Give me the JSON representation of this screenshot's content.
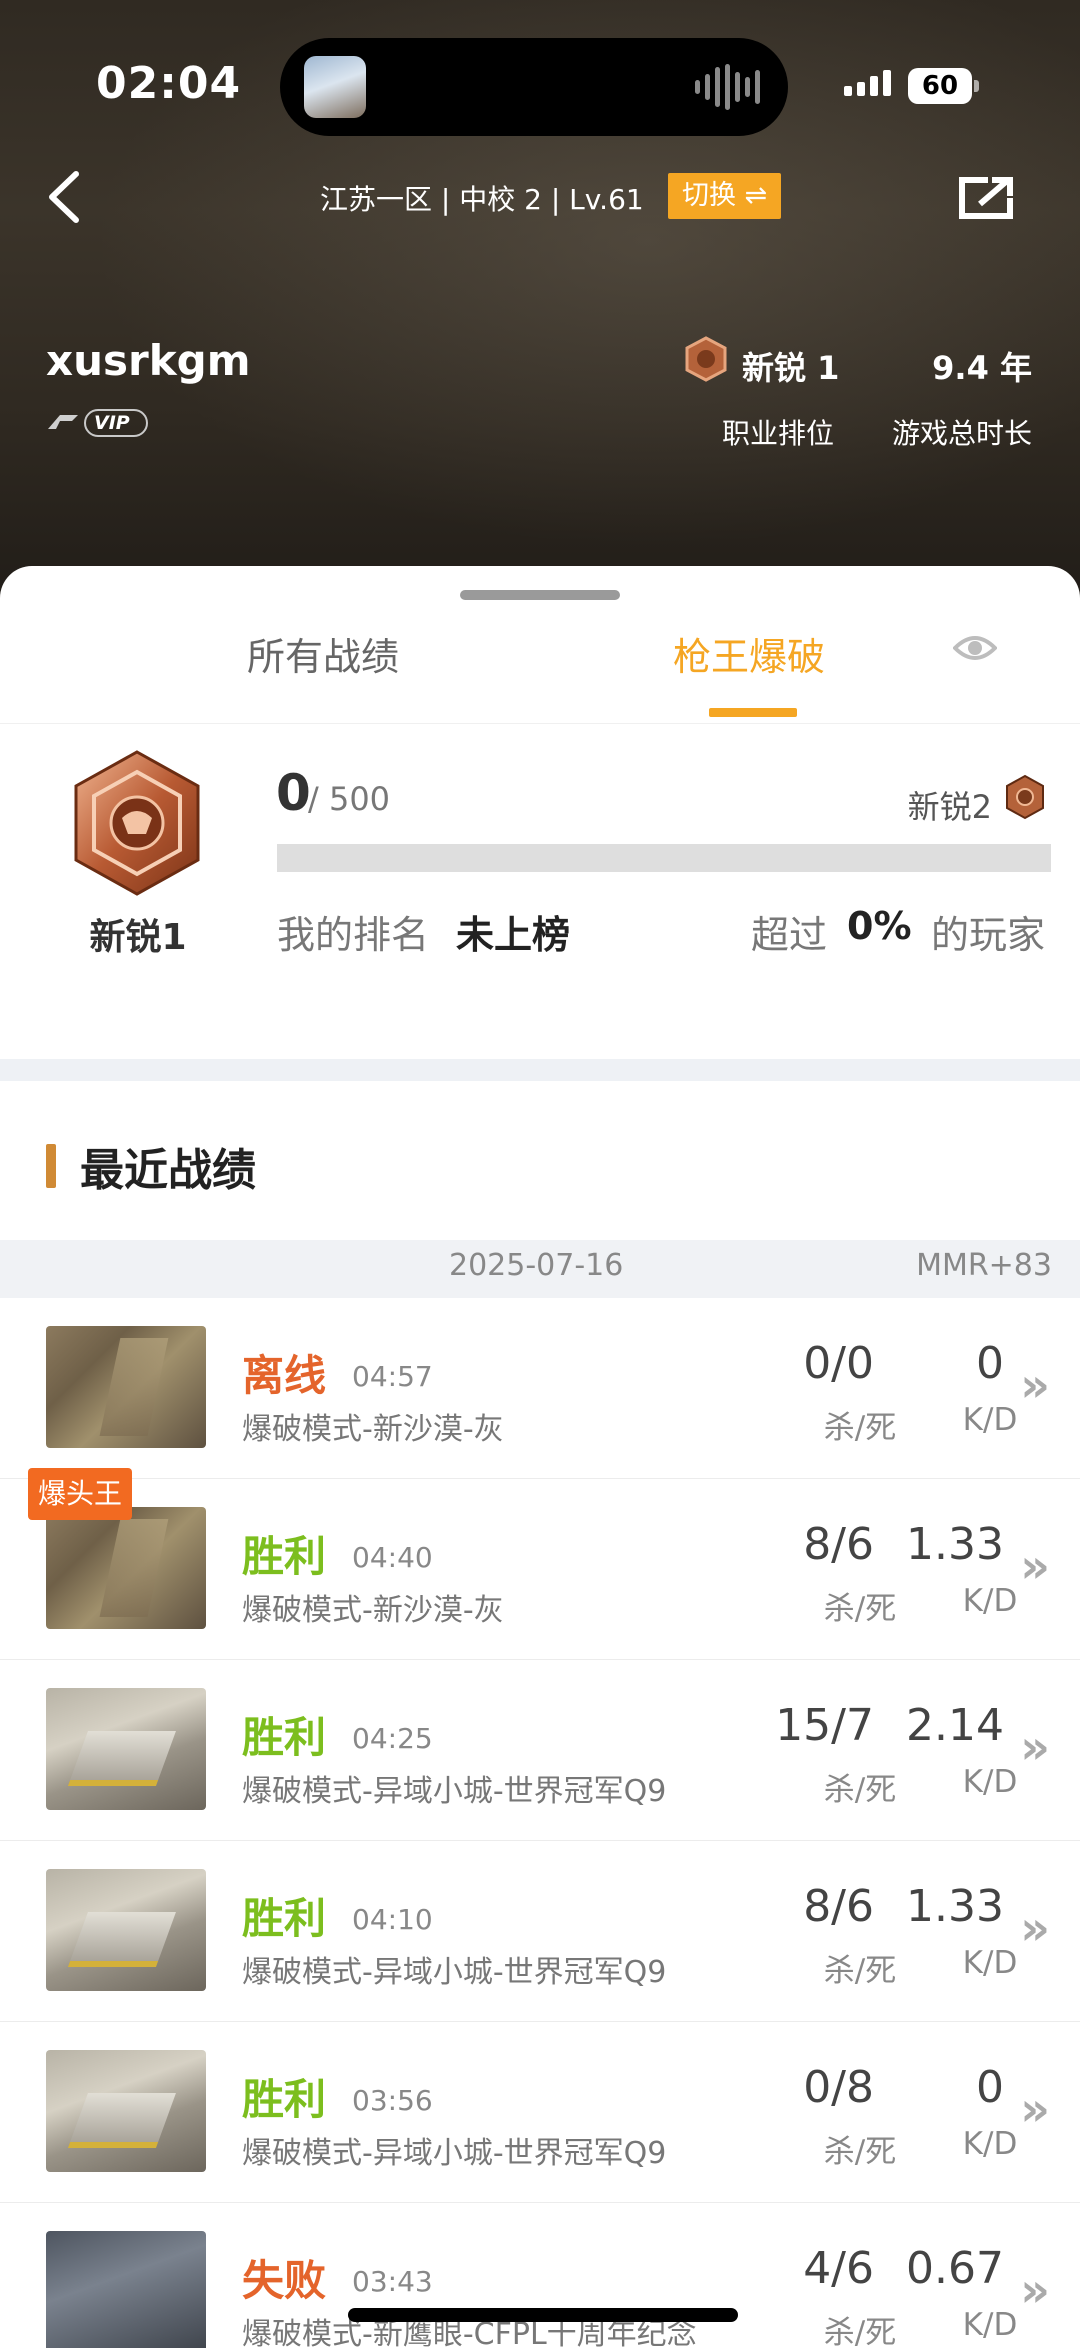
{
  "status_bar": {
    "time": "02:04",
    "battery": "60"
  },
  "header": {
    "server_info": "江苏一区 | 中校 2 | Lv.61",
    "switch_label": "切换 ⇌",
    "username": "xusrkgm",
    "vip_label": "VIP",
    "rank_name": "新锐 1",
    "play_years": "9.4 年",
    "rank_caption": "职业排位",
    "time_caption": "游戏总时长"
  },
  "tabs": [
    {
      "label": "所有战绩"
    },
    {
      "label": "枪王爆破",
      "active": true
    }
  ],
  "rank_card": {
    "medal_label": "新锐1",
    "score": "0",
    "score_total": "/ 500",
    "progress": 0,
    "next_rank": "新锐2",
    "my_rank_label": "我的排名",
    "my_rank_value": "未上榜",
    "beat_label": "超过",
    "beat_value": "0%",
    "beat_suffix": "的玩家"
  },
  "recent": {
    "title": "最近战绩",
    "date": "2025-07-16",
    "mmr": "MMR+83",
    "kd_caption": "杀/死",
    "ratio_caption": "K/D",
    "matches": [
      {
        "result": "离线",
        "result_type": "offline",
        "time": "04:57",
        "mode": "爆破模式-新沙漠-灰",
        "kd": "0/0",
        "ratio": "0",
        "thumb": "desert"
      },
      {
        "result": "胜利",
        "result_type": "win",
        "time": "04:40",
        "mode": "爆破模式-新沙漠-灰",
        "kd": "8/6",
        "ratio": "1.33",
        "thumb": "desert"
      },
      {
        "result": "胜利",
        "result_type": "win",
        "time": "04:25",
        "mode": "爆破模式-异域小城-世界冠军Q9",
        "kd": "15/7",
        "ratio": "2.14",
        "thumb": "city"
      },
      {
        "result": "胜利",
        "result_type": "win",
        "time": "04:10",
        "mode": "爆破模式-异域小城-世界冠军Q9",
        "kd": "8/6",
        "ratio": "1.33",
        "thumb": "city"
      },
      {
        "result": "胜利",
        "result_type": "win",
        "time": "03:56",
        "mode": "爆破模式-异域小城-世界冠军Q9",
        "kd": "0/8",
        "ratio": "0",
        "thumb": "city"
      },
      {
        "result": "失败",
        "result_type": "lose",
        "time": "03:43",
        "mode": "爆破模式-新鹰眼-CFPL十周年纪念",
        "kd": "4/6",
        "ratio": "0.67",
        "thumb": "dark",
        "tag": "爆头王"
      }
    ]
  },
  "colors": {
    "accent": "#f5a623",
    "win": "#7cbe1e",
    "lose": "#e4642b"
  }
}
